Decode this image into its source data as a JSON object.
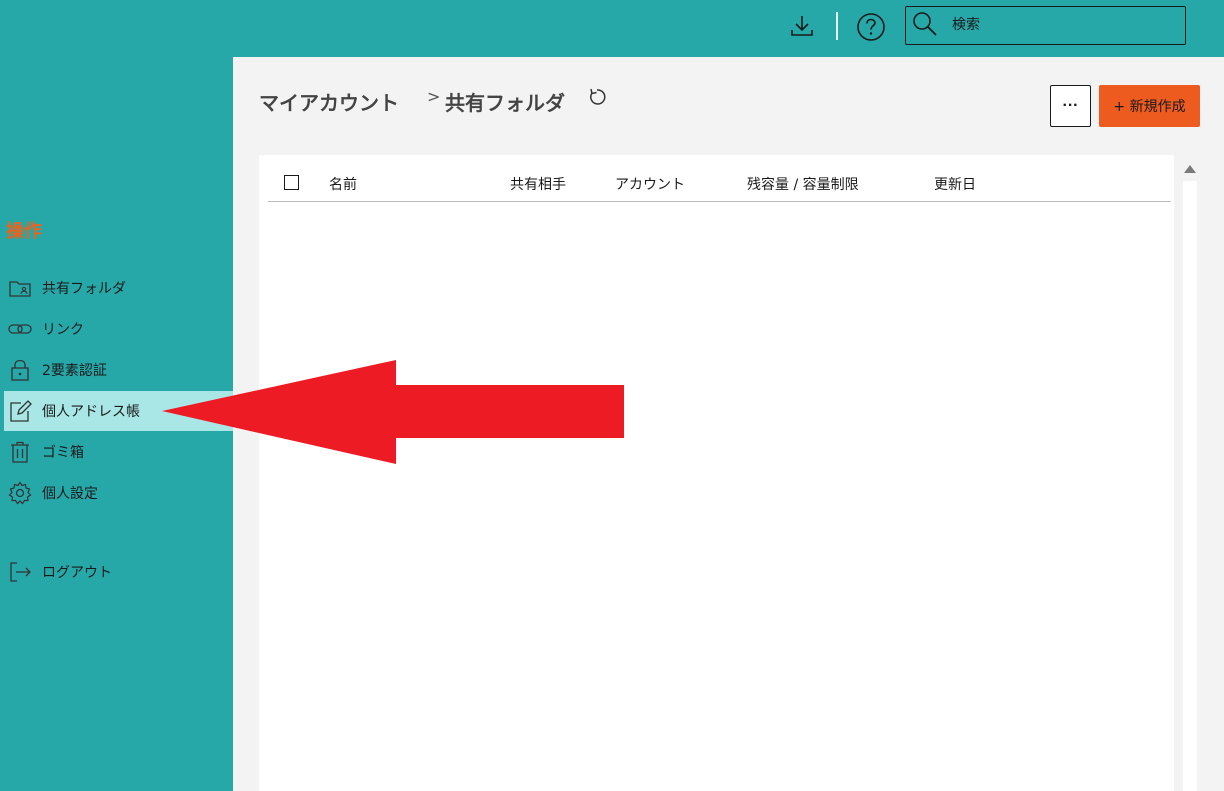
{
  "topbar": {
    "search_placeholder": "検索",
    "download_icon": "download-icon",
    "help_icon": "help-icon"
  },
  "sidebar": {
    "section_title": "操作",
    "items": [
      {
        "label": "共有フォルダ",
        "icon": "shared-folder-icon"
      },
      {
        "label": "リンク",
        "icon": "link-icon"
      },
      {
        "label": "2要素認証",
        "icon": "lock-icon"
      },
      {
        "label": "個人アドレス帳",
        "icon": "edit-icon",
        "active": true
      },
      {
        "label": "ゴミ箱",
        "icon": "trash-icon"
      },
      {
        "label": "個人設定",
        "icon": "gear-icon"
      },
      {
        "label": "ログアウト",
        "icon": "logout-icon"
      }
    ]
  },
  "main": {
    "breadcrumb": {
      "root": "マイアカウント",
      "separator": ">",
      "current": "共有フォルダ"
    },
    "more_label": "···",
    "new_label": "+ 新規作成",
    "table": {
      "columns": [
        "名前",
        "共有相手",
        "アカウント",
        "残容量 / 容量制限",
        "更新日"
      ],
      "rows": []
    }
  },
  "colors": {
    "teal": "#27a8a8",
    "accent_orange": "#ed5b1e",
    "active_item": "#a9e6e6",
    "annotation_red": "#ed1c24"
  }
}
